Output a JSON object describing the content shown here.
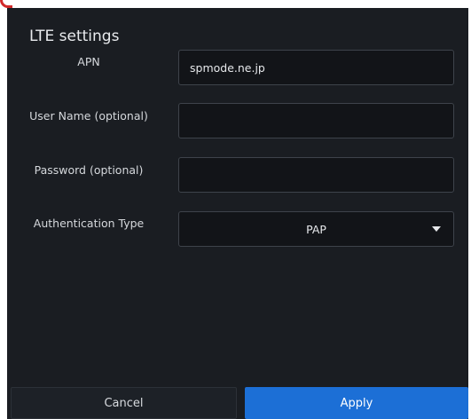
{
  "dialog": {
    "title": "LTE settings",
    "apn": {
      "label": "APN",
      "value": "spmode.ne.jp"
    },
    "username": {
      "label": "User Name (optional)",
      "value": ""
    },
    "password": {
      "label": "Password (optional)",
      "value": ""
    },
    "auth_type": {
      "label": "Authentication Type",
      "selected": "PAP"
    },
    "buttons": {
      "cancel": "Cancel",
      "apply": "Apply"
    }
  },
  "colors": {
    "background": "#1a1d22",
    "field": "#121418",
    "accent": "#1c6fd6",
    "corner_mark": "#d22a2a"
  },
  "icons": {
    "dropdown": "chevron-down-icon"
  }
}
